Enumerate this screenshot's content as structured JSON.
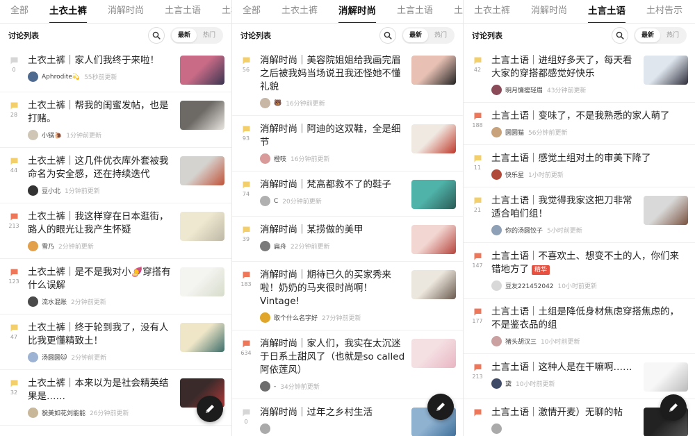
{
  "colors": {
    "accent": "#222222",
    "comment_icon_yellow": "#f3cf6b",
    "comment_icon_orange": "#ee7759",
    "comment_icon_gray": "#d6d6d6",
    "tag_jinghua": "#e8513f"
  },
  "panels": [
    {
      "tabs": [
        "全部",
        "土衣土裤",
        "消解时尚",
        "土言土语",
        "土村"
      ],
      "active_tab": 1,
      "list_title": "讨论列表",
      "sort_options": [
        "最新",
        "热门"
      ],
      "posts": [
        {
          "icon_color": "#d6d6d6",
          "count": "0",
          "title": "土衣土裤｜家人们我终于来啦！",
          "user": "Aphrodite💫",
          "time": "55秒前更新",
          "avatar": "#4e6b8f",
          "thumb": [
            "#c96b87",
            "#3a3550"
          ]
        },
        {
          "icon_color": "#f3cf6b",
          "count": "28",
          "title": "土衣土裤｜帮我的闺蜜发帖，也是打赌。",
          "user": "小锅🐌",
          "time": "1分钟前更新",
          "avatar": "#cfc6b6",
          "thumb": [
            "#6d6a66",
            "#e9e6e1"
          ]
        },
        {
          "icon_color": "#f3cf6b",
          "count": "44",
          "title": "土衣土裤｜这几件优衣库外套被我命名为安全感，还在持续迭代",
          "user": "豆小北",
          "time": "1分钟前更新",
          "avatar": "#333333",
          "thumb": [
            "#d5d3cf",
            "#c0533a"
          ]
        },
        {
          "icon_color": "#ee7759",
          "count": "213",
          "title": "土衣土裤｜我这样穿在日本逛街，路人的眼光让我产生怀疑",
          "user": "雪乃",
          "time": "2分钟前更新",
          "avatar": "#e3a04a",
          "thumb": [
            "#efe8d0",
            "#bdb8a6"
          ]
        },
        {
          "icon_color": "#ee7759",
          "count": "123",
          "title": "土衣土裤｜是不是我对小🍠穿搭有什么误解",
          "user": "流水混账",
          "time": "2分钟前更新",
          "avatar": "#4a4a4a",
          "thumb": [
            "#f4f4f0",
            "#d6dccb"
          ]
        },
        {
          "icon_color": "#f3cf6b",
          "count": "47",
          "title": "土衣土裤｜终于轮到我了，没有人比我更懂精致土！",
          "user": "汤圆圆🐱",
          "time": "2分钟前更新",
          "avatar": "#9db3d4",
          "thumb": [
            "#efe6c8",
            "#3d6d6a"
          ]
        },
        {
          "icon_color": "#f3cf6b",
          "count": "32",
          "title": "土衣土裤｜本来以为是社会精英结果是……",
          "user": "貌美如花刘能能",
          "time": "26分钟前更新",
          "avatar": "#c9b79a",
          "thumb": [
            "#3a2a2a",
            "#b23a3a"
          ]
        }
      ]
    },
    {
      "tabs": [
        "全部",
        "土衣土裤",
        "消解时尚",
        "土言土语",
        "土村"
      ],
      "active_tab": 2,
      "list_title": "讨论列表",
      "sort_options": [
        "最新",
        "热门"
      ],
      "posts": [
        {
          "icon_color": "#f3cf6b",
          "count": "56",
          "title": "消解时尚｜美容院姐姐给我画完眉之后被我妈当场说丑我还怪她不懂礼貌",
          "user": "🐻",
          "time": "16分钟前更新",
          "avatar": "#c8b7a4",
          "thumb": [
            "#e8c1b4",
            "#222222"
          ]
        },
        {
          "icon_color": "#f3cf6b",
          "count": "93",
          "title": "消解时尚｜阿迪的这双鞋，全是细节",
          "user": "橙吱",
          "time": "16分钟前更新",
          "avatar": "#d99a9a",
          "thumb": [
            "#efe9e2",
            "#c0392b"
          ]
        },
        {
          "icon_color": "#f3cf6b",
          "count": "74",
          "title": "消解时尚｜梵高都救不了的鞋子",
          "user": "C",
          "time": "20分钟前更新",
          "avatar": "#b0b0b0",
          "thumb": [
            "#4fb3a9",
            "#2b5a56"
          ]
        },
        {
          "icon_color": "#f3cf6b",
          "count": "39",
          "title": "消解时尚｜某捞做的美甲",
          "user": "扁舟",
          "time": "22分钟前更新",
          "avatar": "#7a7a7a",
          "thumb": [
            "#f2d6d2",
            "#b5443c"
          ]
        },
        {
          "icon_color": "#ee7759",
          "count": "183",
          "title": "消解时尚｜期待已久的买家秀来啦！奶奶的马夹很时尚啊！Vintage!",
          "user": "取个什么名字好",
          "time": "27分钟前更新",
          "avatar": "#e0a62b",
          "thumb": [
            "#ece7de",
            "#6b5a4e"
          ]
        },
        {
          "icon_color": "#ee7759",
          "count": "634",
          "title": "消解时尚｜家人们，我实在太沉迷于日系土甜风了（也就是so called阿依莲风）",
          "user": "-",
          "time": "34分钟前更新",
          "avatar": "#6d6d6d",
          "thumb": [
            "#f4dfe3",
            "#e9b5c3"
          ]
        },
        {
          "icon_color": "#d6d6d6",
          "count": "0",
          "title": "消解时尚｜过年之乡村生活",
          "user": "",
          "time": "",
          "avatar": "#aaaaaa",
          "thumb": [
            "#8fb2d1",
            "#3f6f9a"
          ]
        }
      ]
    },
    {
      "tabs": [
        "土衣土裤",
        "消解时尚",
        "土言土语",
        "土村告示"
      ],
      "active_tab": 2,
      "list_title": "讨论列表",
      "sort_options": [
        "最新",
        "热门"
      ],
      "posts": [
        {
          "icon_color": "#f3cf6b",
          "count": "42",
          "title": "土言土语｜进组好多天了，每天看大家的穿搭都感觉好快乐",
          "user": "明月慵瘦轻眉",
          "time": "43分钟前更新",
          "avatar": "#8a4a58",
          "thumb": [
            "#dfe6ee",
            "#2e2e3a"
          ]
        },
        {
          "icon_color": "#ee7759",
          "count": "188",
          "title": "土言土语｜变味了，不是我熟悉的家人萌了",
          "user": "圆圆猫",
          "time": "56分钟前更新",
          "avatar": "#c7a27a",
          "thumb": null
        },
        {
          "icon_color": "#f3cf6b",
          "count": "11",
          "title": "土言土语｜感觉土组对土的审美下降了",
          "user": "快乐星",
          "time": "1小时前更新",
          "avatar": "#b04a3a",
          "thumb": null
        },
        {
          "icon_color": "#f3cf6b",
          "count": "21",
          "title": "土言土语｜我觉得我家这把刀非常适合咱们组！",
          "user": "你的汤圆饺子",
          "time": "5小时前更新",
          "avatar": "#8ea0b5",
          "thumb": [
            "#d9d9d9",
            "#7a5240"
          ]
        },
        {
          "icon_color": "#ee7759",
          "count": "147",
          "title": "土言土语｜不喜欢土、想变不土的人，你们来错地方了",
          "tag": "精华",
          "user": "豆友221452042",
          "time": "10小时前更新",
          "avatar": "#d8d8d8",
          "thumb": null
        },
        {
          "icon_color": "#ee7759",
          "count": "177",
          "title": "土言土语｜土组是降低身材焦虑穿搭焦虑的，不是鉴衣品的组",
          "user": "猪头胡汉三",
          "time": "10小时前更新",
          "avatar": "#caa0a0",
          "thumb": null
        },
        {
          "icon_color": "#ee7759",
          "count": "213",
          "title": "土言土语｜这种人是在干嘛啊……",
          "user": "黛",
          "time": "10小时前更新",
          "avatar": "#3e4a66",
          "thumb": [
            "#f7f7f7",
            "#bbbbbb"
          ]
        },
        {
          "icon_color": "#ee7759",
          "count": "",
          "title": "土言土语｜激情开麦）无聊的帖",
          "user": "",
          "time": "",
          "avatar": "#aaaaaa",
          "thumb": [
            "#222222",
            "#555555"
          ]
        }
      ]
    }
  ]
}
